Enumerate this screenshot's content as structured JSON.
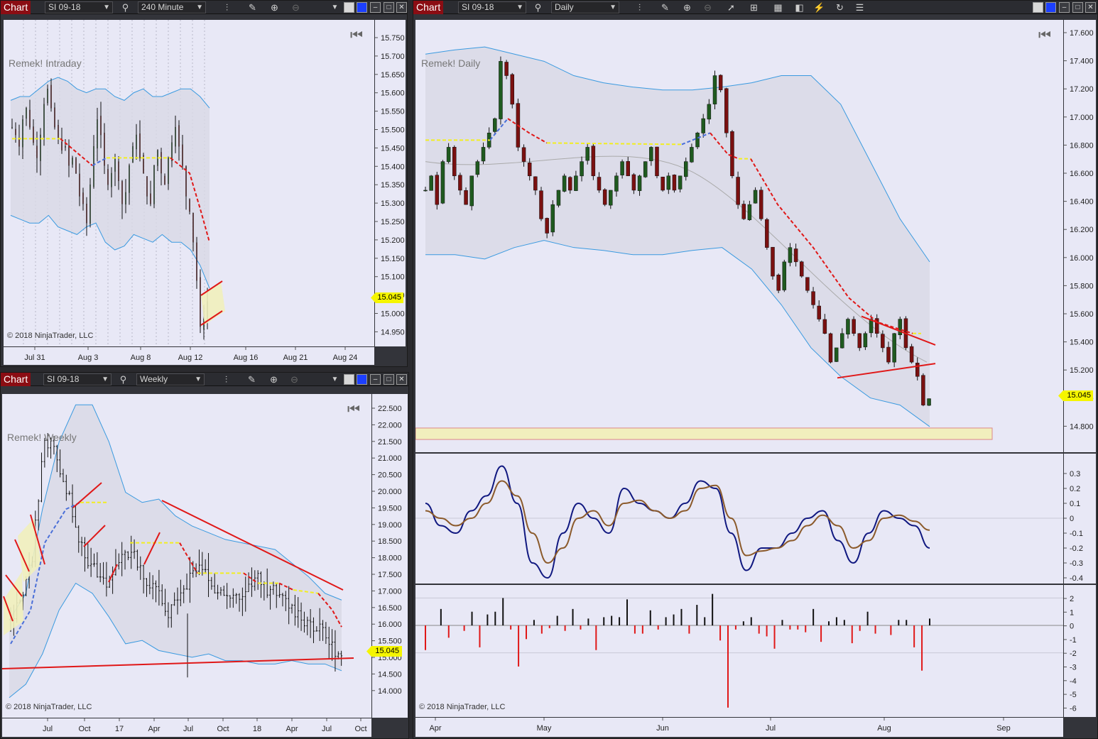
{
  "common": {
    "chart_button": "Chart",
    "instrument": "SI 09-18",
    "copyright": "© 2018 NinjaTrader, LLC",
    "last_price": "15.045",
    "colors": {
      "background": "#e8e8f6",
      "bull_candle": "#1f5a1f",
      "bear_candle": "#7a1010",
      "ma_up": "#4a6fd8",
      "ma_flat": "#f2ee20",
      "ma_down": "#e01818",
      "band_line": "#3a9ae0",
      "trend_line": "#e01818",
      "price_tag": "#f5f500",
      "oscillator_fast": "#101880",
      "oscillator_slow": "#8b5a2b"
    }
  },
  "windows": {
    "intraday": {
      "timeframe": "240 Minute",
      "indicator_label": "Remek! Intraday",
      "x_ticks": [
        "Jul 31",
        "Aug 3",
        "Aug 8",
        "Aug 12",
        "Aug 16",
        "Aug 21",
        "Aug 24"
      ],
      "y_ticks": [
        "15.750",
        "15.700",
        "15.650",
        "15.600",
        "15.550",
        "15.500",
        "15.450",
        "15.400",
        "15.350",
        "15.300",
        "15.250",
        "15.200",
        "15.150",
        "15.100",
        "15.050",
        "15.000",
        "14.950"
      ]
    },
    "weekly": {
      "timeframe": "Weekly",
      "indicator_label": "Remek! Weekly",
      "x_ticks": [
        "Jul",
        "Oct",
        "17",
        "Apr",
        "Jul",
        "Oct",
        "18",
        "Apr",
        "Jul",
        "Oct"
      ],
      "y_ticks": [
        "22.500",
        "22.000",
        "21.500",
        "21.000",
        "20.500",
        "20.000",
        "19.500",
        "19.000",
        "18.500",
        "18.000",
        "17.500",
        "17.000",
        "16.500",
        "16.000",
        "15.500",
        "15.000",
        "14.500",
        "14.000"
      ]
    },
    "daily": {
      "timeframe": "Daily",
      "indicator_label": "Remek! Daily",
      "x_ticks": [
        "Apr",
        "May",
        "Jun",
        "Jul",
        "Aug",
        "Sep"
      ],
      "y_ticks": [
        "17.600",
        "17.400",
        "17.200",
        "17.000",
        "16.800",
        "16.600",
        "16.400",
        "16.200",
        "16.000",
        "15.800",
        "15.600",
        "15.400",
        "15.200",
        "15.000",
        "14.800"
      ],
      "oscillator_ticks": [
        "0.3",
        "0.2",
        "0.1",
        "0",
        "-0.1",
        "-0.2",
        "-0.3",
        "-0.4"
      ],
      "histogram_ticks": [
        "2",
        "1",
        "0",
        "-1",
        "-2",
        "-3",
        "-4",
        "-5",
        "-6"
      ]
    }
  },
  "chart_data": [
    {
      "type": "candlestick",
      "panel": "intraday",
      "instrument": "SI 09-18",
      "timeframe": "240 Minute",
      "ylim": [
        14.93,
        15.78
      ],
      "close_last": 15.045,
      "closes": [
        15.5,
        15.48,
        15.45,
        15.52,
        15.55,
        15.5,
        15.46,
        15.42,
        15.48,
        15.56,
        15.6,
        15.55,
        15.5,
        15.47,
        15.44,
        15.45,
        15.4,
        15.42,
        15.38,
        15.32,
        15.3,
        15.25,
        15.35,
        15.45,
        15.52,
        15.48,
        15.4,
        15.35,
        15.38,
        15.42,
        15.36,
        15.3,
        15.33,
        15.4,
        15.45,
        15.48,
        15.42,
        15.38,
        15.32,
        15.3,
        15.4,
        15.44,
        15.38,
        15.35,
        15.42,
        15.46,
        15.5,
        15.45,
        15.4,
        15.32,
        15.28,
        15.2,
        15.1,
        14.98,
        15.0,
        15.045
      ],
      "upper_band": [
        15.57,
        15.58,
        15.58,
        15.6,
        15.62,
        15.63,
        15.62,
        15.6,
        15.59,
        15.6,
        15.6,
        15.58,
        15.57,
        15.59,
        15.6,
        15.58,
        15.58,
        15.59,
        15.6,
        15.6,
        15.58,
        15.55
      ],
      "lower_band": [
        15.27,
        15.26,
        15.25,
        15.25,
        15.27,
        15.24,
        15.23,
        15.22,
        15.24,
        15.25,
        15.2,
        15.18,
        15.19,
        15.22,
        15.21,
        15.2,
        15.22,
        15.2,
        15.2,
        15.18,
        15.14,
        15.08
      ],
      "trend_lines": [
        {
          "from": 15.05,
          "to": 15.15
        },
        {
          "from": 14.97,
          "to": 15.01
        }
      ]
    },
    {
      "type": "candlestick",
      "panel": "weekly",
      "instrument": "SI 09-18",
      "timeframe": "Weekly",
      "ylim": [
        13.6,
        22.8
      ],
      "close_last": 15.045,
      "trend_lines": [
        {
          "from": 17.9,
          "to": 17.1
        },
        {
          "from": 14.2,
          "to": 14.6
        }
      ]
    },
    {
      "type": "candlestick",
      "panel": "daily",
      "instrument": "SI 09-18",
      "timeframe": "Daily",
      "ylim": [
        14.7,
        17.7
      ],
      "close_last": 15.045,
      "closes": [
        16.5,
        16.6,
        16.4,
        16.7,
        16.8,
        16.6,
        16.5,
        16.4,
        16.6,
        16.7,
        16.8,
        16.9,
        17.0,
        17.4,
        17.3,
        17.1,
        16.8,
        16.7,
        16.6,
        16.5,
        16.3,
        16.2,
        16.4,
        16.5,
        16.6,
        16.5,
        16.6,
        16.7,
        16.8,
        16.6,
        16.5,
        16.4,
        16.5,
        16.6,
        16.7,
        16.6,
        16.5,
        16.6,
        16.7,
        16.8,
        16.6,
        16.5,
        16.6,
        16.5,
        16.6,
        16.7,
        16.8,
        16.9,
        17.0,
        17.1,
        17.3,
        17.2,
        16.9,
        16.6,
        16.4,
        16.3,
        16.4,
        16.5,
        16.3,
        16.1,
        15.9,
        15.8,
        16.0,
        16.1,
        16.0,
        15.9,
        15.8,
        15.7,
        15.6,
        15.5,
        15.3,
        15.4,
        15.5,
        15.6,
        15.5,
        15.4,
        15.5,
        15.6,
        15.5,
        15.4,
        15.3,
        15.5,
        15.6,
        15.4,
        15.3,
        15.2,
        15.0,
        15.045
      ],
      "upper_band": [
        17.45,
        17.48,
        17.5,
        17.45,
        17.4,
        17.3,
        17.25,
        17.22,
        17.2,
        17.2,
        17.22,
        17.25,
        17.3,
        17.3,
        17.1,
        16.7,
        16.3,
        16.0
      ],
      "lower_band": [
        16.05,
        16.05,
        16.02,
        16.1,
        16.15,
        16.1,
        16.08,
        16.05,
        16.05,
        16.08,
        16.1,
        15.95,
        15.7,
        15.4,
        15.2,
        15.05,
        15.0,
        14.85
      ],
      "support_zone": [
        14.76,
        14.84
      ],
      "trend_lines": [
        {
          "from": 15.58,
          "to": 15.44
        },
        {
          "from": 15.19,
          "to": 15.29
        }
      ]
    },
    {
      "type": "line",
      "panel": "daily-oscillator",
      "ylim": [
        -0.45,
        0.4
      ],
      "series": [
        {
          "values": [
            0.1,
            -0.05,
            -0.1,
            0.05,
            0.15,
            0.35,
            0.1,
            -0.3,
            -0.4,
            -0.1,
            0.1,
            0.0,
            -0.1,
            0.2,
            0.1,
            0.05,
            0.0,
            0.1,
            0.25,
            0.2,
            -0.1,
            -0.35,
            -0.2,
            -0.2,
            -0.1,
            0.0,
            0.05,
            -0.15,
            -0.3,
            -0.1,
            0.05,
            0.0,
            -0.05,
            -0.2
          ]
        },
        {
          "values": [
            0.05,
            0.0,
            -0.05,
            0.0,
            0.1,
            0.25,
            0.15,
            -0.1,
            -0.3,
            -0.2,
            0.0,
            0.05,
            -0.05,
            0.1,
            0.12,
            0.05,
            0.0,
            0.05,
            0.2,
            0.22,
            0.0,
            -0.25,
            -0.22,
            -0.2,
            -0.15,
            -0.05,
            0.02,
            -0.05,
            -0.2,
            -0.15,
            0.0,
            0.02,
            -0.02,
            -0.08
          ]
        }
      ]
    },
    {
      "type": "bar",
      "panel": "daily-histogram",
      "ylim": [
        -6.5,
        2.6
      ],
      "values": [
        -1.8,
        0.0,
        1.2,
        -0.9,
        0.0,
        -0.4,
        1.0,
        -1.6,
        0.8,
        1.0,
        2.0,
        -0.3,
        -3.0,
        -1.0,
        0.4,
        -0.6,
        -0.2,
        0.7,
        -0.4,
        1.2,
        -0.3,
        0.5,
        -1.8,
        0.6,
        0.7,
        0.6,
        1.9,
        -0.6,
        -0.6,
        1.1,
        -0.3,
        0.6,
        0.8,
        1.2,
        -0.6,
        1.5,
        0.6,
        2.3,
        -1.1,
        -6.0,
        -0.3,
        0.3,
        0.6,
        -0.6,
        -0.8,
        -1.7,
        0.4,
        -0.3,
        -0.3,
        -0.5,
        1.2,
        -1.2,
        0.3,
        0.6,
        0.4,
        -1.3,
        -0.4,
        1.0,
        -0.6,
        0.0,
        -0.7,
        0.4,
        0.4,
        -1.6,
        -3.3,
        0.5
      ]
    }
  ]
}
